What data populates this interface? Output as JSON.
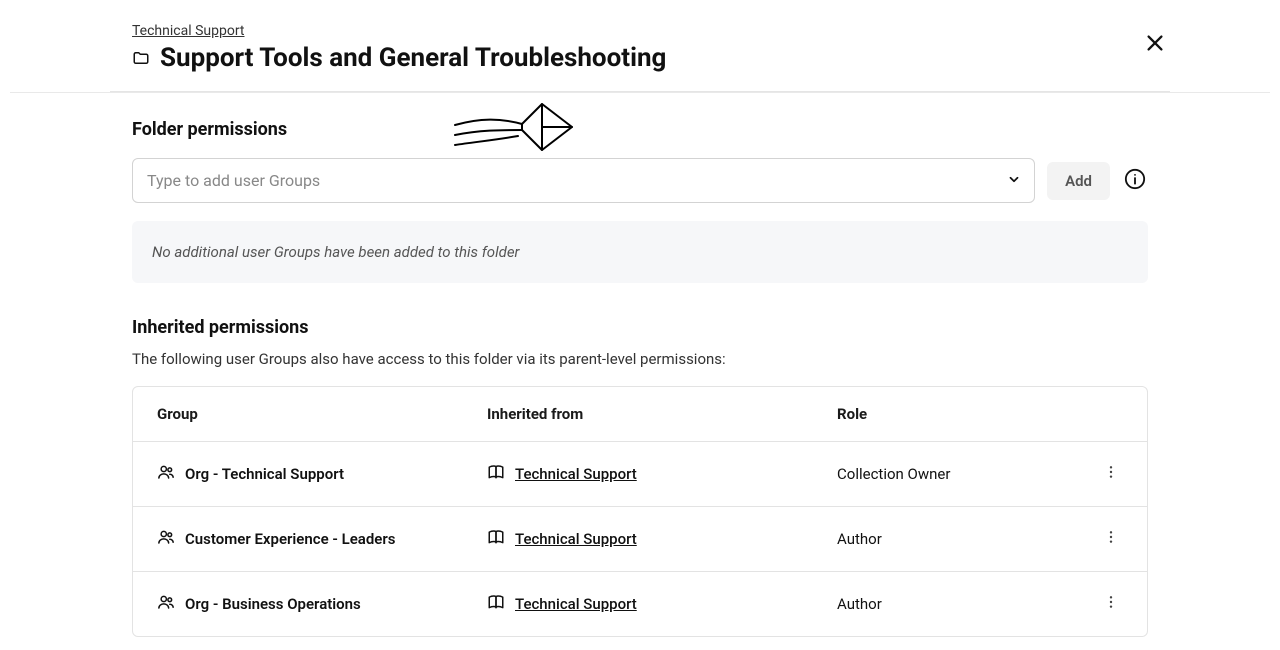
{
  "breadcrumb": {
    "parent": "Technical Support"
  },
  "page": {
    "title": "Support Tools and General Troubleshooting"
  },
  "folder_permissions": {
    "title": "Folder permissions",
    "search_placeholder": "Type to add user Groups",
    "add_label": "Add",
    "empty_message": "No additional user Groups have been added to this folder"
  },
  "inherited": {
    "title": "Inherited permissions",
    "description": "The following user Groups also have access to this folder via its parent-level permissions:",
    "columns": {
      "group": "Group",
      "from": "Inherited from",
      "role": "Role"
    },
    "rows": [
      {
        "group": "Org - Technical Support",
        "from": "Technical Support",
        "role": "Collection Owner"
      },
      {
        "group": "Customer Experience - Leaders",
        "from": "Technical Support",
        "role": "Author"
      },
      {
        "group": "Org - Business Operations",
        "from": "Technical Support",
        "role": "Author"
      }
    ]
  },
  "icons": {
    "folder": "folder-icon",
    "close": "close-icon",
    "chevron_down": "chevron-down-icon",
    "info": "info-icon",
    "people": "people-icon",
    "book": "book-icon",
    "kebab": "more-vertical-icon"
  }
}
